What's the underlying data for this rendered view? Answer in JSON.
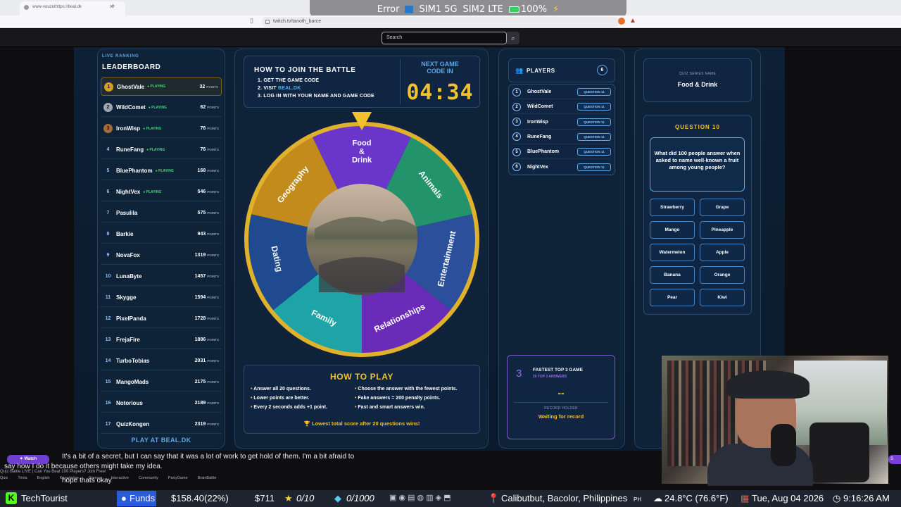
{
  "browser": {
    "tab_title": "www-vouzethttps://beal.dk",
    "address": "twitch.tv/tanoth_barce",
    "status": {
      "error_label": "Error",
      "sim1": "SIM1 5G",
      "sim2": "SIM2 LTE",
      "battery": "100%",
      "battery_pct": 100
    }
  },
  "twitch": {
    "search_placeholder": "Search"
  },
  "leaderboard": {
    "kicker": "LIVE RANKING",
    "title": "LEADERBOARD",
    "points_unit": "POINTS",
    "playing_label": "PLAYING",
    "footer": "PLAY AT BEAL.DK",
    "rows": [
      {
        "rank": "1",
        "name": "GhostVale",
        "playing": true,
        "points": "32"
      },
      {
        "rank": "2",
        "name": "WildComet",
        "playing": true,
        "points": "62"
      },
      {
        "rank": "3",
        "name": "IronWisp",
        "playing": true,
        "points": "76"
      },
      {
        "rank": "4",
        "name": "RuneFang",
        "playing": true,
        "points": "76"
      },
      {
        "rank": "5",
        "name": "BluePhantom",
        "playing": true,
        "points": "168"
      },
      {
        "rank": "6",
        "name": "NightVex",
        "playing": true,
        "points": "546"
      },
      {
        "rank": "7",
        "name": "Pasulila",
        "playing": false,
        "points": "575"
      },
      {
        "rank": "8",
        "name": "Barkie",
        "playing": false,
        "points": "943"
      },
      {
        "rank": "9",
        "name": "NovaFox",
        "playing": false,
        "points": "1319"
      },
      {
        "rank": "10",
        "name": "LunaByte",
        "playing": false,
        "points": "1457"
      },
      {
        "rank": "11",
        "name": "Skygge",
        "playing": false,
        "points": "1594"
      },
      {
        "rank": "12",
        "name": "PixelPanda",
        "playing": false,
        "points": "1728"
      },
      {
        "rank": "13",
        "name": "FrejaFire",
        "playing": false,
        "points": "1886"
      },
      {
        "rank": "14",
        "name": "TurboTobias",
        "playing": false,
        "points": "2031"
      },
      {
        "rank": "15",
        "name": "MangoMads",
        "playing": false,
        "points": "2175"
      },
      {
        "rank": "16",
        "name": "Notorious",
        "playing": false,
        "points": "2189"
      },
      {
        "rank": "17",
        "name": "QuizKongen",
        "playing": false,
        "points": "2319"
      }
    ]
  },
  "join": {
    "title": "HOW TO JOIN THE BATTLE",
    "steps": [
      "1. GET THE GAME CODE",
      "2. VISIT",
      "3. LOG IN WITH YOUR NAME AND GAME CODE"
    ],
    "visit_link": "BEAL.DK",
    "next_label": "NEXT GAME CODE IN",
    "timer": "04:34"
  },
  "wheel": {
    "segments": [
      {
        "label": "Food & Drink",
        "color": "#6a35c9"
      },
      {
        "label": "Animals",
        "color": "#22936a"
      },
      {
        "label": "Entertainment",
        "color": "#2b4f9a"
      },
      {
        "label": "Relationships",
        "color": "#6a2bb8"
      },
      {
        "label": "Family",
        "color": "#1ea3a6"
      },
      {
        "label": "Dating",
        "color": "#1f4a8f"
      },
      {
        "label": "Geography",
        "color": "#c38a1c"
      }
    ],
    "rim_color": "#e0b12a"
  },
  "howplay": {
    "title": "HOW TO PLAY",
    "rules_left": [
      "Answer all 20 questions.",
      "Lower points are better.",
      "Every 2 seconds adds +1 point."
    ],
    "rules_right": [
      "Choose the answer with the fewest points.",
      "Fake answers = 200 penalty points.",
      "Fast and smart answers win."
    ],
    "footer": "🏆 Lowest total score after 20 questions wins!"
  },
  "players": {
    "title": "PLAYERS",
    "count": "6",
    "question_label": "QUESTION 11",
    "list": [
      {
        "num": "1",
        "name": "GhostVale"
      },
      {
        "num": "2",
        "name": "WildComet"
      },
      {
        "num": "3",
        "name": "IronWisp"
      },
      {
        "num": "4",
        "name": "RuneFang"
      },
      {
        "num": "5",
        "name": "BluePhantom"
      },
      {
        "num": "6",
        "name": "NightVex"
      }
    ],
    "fastest": {
      "num": "3",
      "title": "FASTEST TOP 3 GAME",
      "subtitle": "20 TOP 3 ANSWERS",
      "value": "--",
      "record_label": "RECORD HOLDER",
      "record_value": "Waiting for record"
    }
  },
  "quiz": {
    "series_label": "QUIZ SERIES NAME",
    "series_name": "Food & Drink",
    "question_num": "QUESTION 10",
    "question": "What did 100 people answer when asked to name well-known a fruit among young people?",
    "answers": [
      "Strawberry",
      "Grape",
      "Mango",
      "Pineapple",
      "Watermelon",
      "Apple",
      "Banana",
      "Orange",
      "Pear",
      "Kiwi"
    ]
  },
  "chat": {
    "badge": "✦ Watch",
    "line1": "It's a bit of a secret, but I can say that it was a lot of work to get hold of them. I'm a bit afraid to",
    "line2": "say how I do it because others might take my idea.",
    "line3": "hope thats okay",
    "title": "Quiz Battle LIVE | Can You Beat 100 Players? Join Free!",
    "tags": [
      "Quiz",
      "Trivia",
      "English",
      "Knowledge",
      "Games",
      "Interactive",
      "Community",
      "PartyGame",
      "BrainBattle"
    ]
  },
  "taskbar": {
    "app": "TechTourist",
    "funds": "Funds",
    "balance": "$158.40(22%)",
    "amount": "$711",
    "stars": "0/10",
    "gems": "0/1000",
    "location": "Calibutbut, Bacolor, Philippines",
    "country": "PH",
    "weather": "24.8°C (76.6°F)",
    "date": "Tue, Aug 04 2026",
    "time": "9:16:26 AM"
  }
}
